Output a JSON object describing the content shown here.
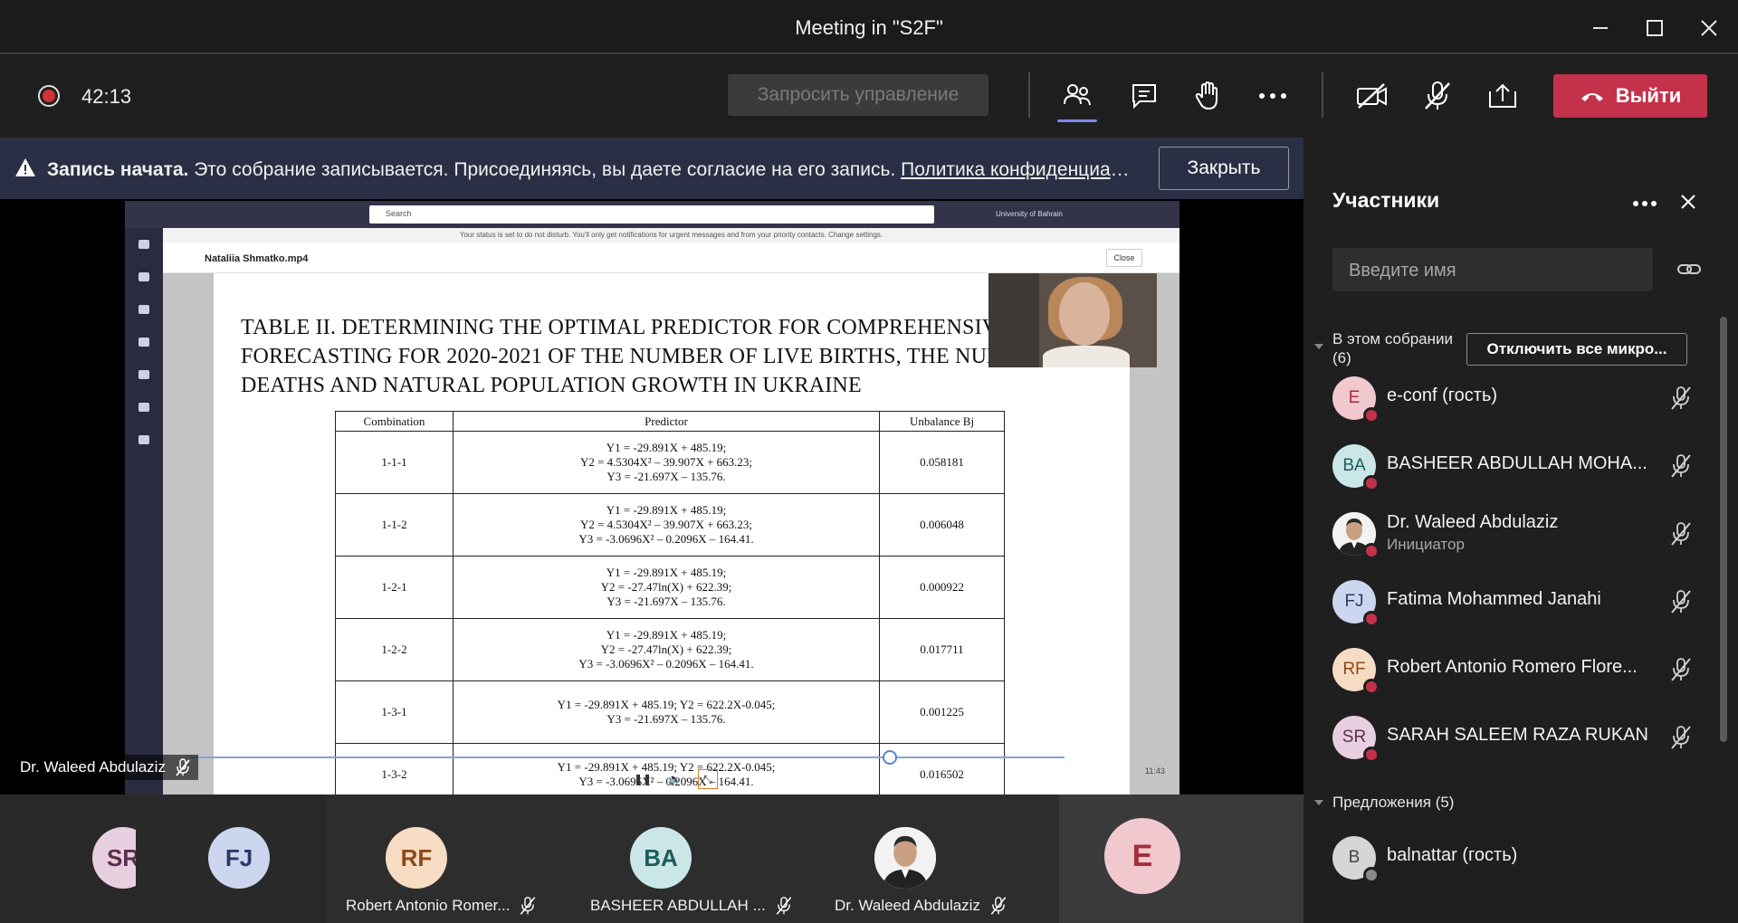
{
  "window": {
    "title": "Meeting in \"S2F\""
  },
  "toolbar": {
    "timer": "42:13",
    "request_control": "Запросить управление",
    "leave_label": "Выйти",
    "accent_leave": "#c4314b"
  },
  "banner": {
    "bold": "Запись начата.",
    "text": " Это собрание записывается. Присоединяясь, вы даете согласие на его запись. ",
    "link": "Политика конфиденциаль...",
    "close_label": "Закрыть"
  },
  "shared_screen": {
    "search_placeholder": "Search",
    "org_label": "University of Bahrain",
    "notice": "Your status is set to do not disturb. You'll only get notifications for urgent messages and from your priority contacts. Change settings.",
    "file_name": "Nataliia Shmatko.mp4",
    "close_label": "Close",
    "slide_title": "TABLE II. DETERMINING THE OPTIMAL PREDICTOR FOR COMPREHENSIVE FORECASTING FOR 2020-2021 OF THE NUMBER OF LIVE BIRTHS, THE NUMBER OF DEATHS AND NATURAL POPULATION GROWTH IN UKRAINE",
    "table_headers": [
      "Combination",
      "Predictor",
      "Unbalance Bj"
    ],
    "table_rows": [
      {
        "combination": "1-1-1",
        "predictor": "Y1 = -29.891X + 485.19;\nY2 = 4.5304X² – 39.907X + 663.23;\nY3 = -21.697X – 135.76.",
        "unbalance": "0.058181"
      },
      {
        "combination": "1-1-2",
        "predictor": "Y1 = -29.891X + 485.19;\nY2 = 4.5304X² – 39.907X + 663.23;\nY3 = -3.0696X² – 0.2096X – 164.41.",
        "unbalance": "0.006048"
      },
      {
        "combination": "1-2-1",
        "predictor": "Y1 = -29.891X + 485.19;\nY2 = -27.47ln(X) + 622.39;\nY3 = -21.697X – 135.76.",
        "unbalance": "0.000922"
      },
      {
        "combination": "1-2-2",
        "predictor": "Y1 = -29.891X + 485.19;\nY2 = -27.47ln(X) + 622.39;\nY3 = -3.0696X² – 0.2096X – 164.41.",
        "unbalance": "0.017711"
      },
      {
        "combination": "1-3-1",
        "predictor": "Y1 = -29.891X + 485.19; Y2 = 622.2X-0.045;\nY3 = -21.697X – 135.76.",
        "unbalance": "0.001225"
      },
      {
        "combination": "1-3-2",
        "predictor": "Y1 = -29.891X + 485.19; Y2 = 622.2X-0.045;\nY3 = -3.0696X² – 0.2096X – 164.41.",
        "unbalance": "0.016502"
      }
    ],
    "video_time": "11:43",
    "playback_progress": 0.8
  },
  "speaker": {
    "name": "Dr. Waleed Abdulaziz"
  },
  "tiles": [
    {
      "initials": "SR",
      "name": "",
      "bg": "#e8cfe0",
      "fg": "#5c2d4f"
    },
    {
      "initials": "FJ",
      "name": "",
      "bg": "#cdd6ef",
      "fg": "#2a3a6a"
    },
    {
      "initials": "RF",
      "name": "Robert Antonio Romer...",
      "bg": "#f7dcc4",
      "fg": "#8a4a1a"
    },
    {
      "initials": "BA",
      "name": "BASHEER ABDULLAH ...",
      "bg": "#cbe6e6",
      "fg": "#1e5c5c"
    },
    {
      "initials": "",
      "name": "Dr. Waleed Abdulaziz",
      "bg": "#e8e8e8",
      "fg": "#333"
    },
    {
      "initials": "E",
      "name": "",
      "bg": "#f2c8cf",
      "fg": "#a52e3e"
    }
  ],
  "panel": {
    "title": "Участники",
    "search_placeholder": "Введите имя",
    "in_meeting": "В этом собрании\n(6)",
    "mute_all": "Отключить все микро...",
    "participants": [
      {
        "initials": "E",
        "name": "e-conf (гость)",
        "sub": "",
        "bg": "#f2c8cf",
        "fg": "#a52e3e"
      },
      {
        "initials": "BA",
        "name": "BASHEER ABDULLAH MOHA...",
        "sub": "",
        "bg": "#cbe6e6",
        "fg": "#1e5c5c"
      },
      {
        "initials": "",
        "name": "Dr. Waleed Abdulaziz",
        "sub": "Инициатор",
        "bg": "#e8e8e8",
        "fg": "#333"
      },
      {
        "initials": "FJ",
        "name": "Fatima Mohammed Janahi",
        "sub": "",
        "bg": "#cdd6ef",
        "fg": "#2a3a6a"
      },
      {
        "initials": "RF",
        "name": "Robert Antonio Romero Flore...",
        "sub": "",
        "bg": "#f7dcc4",
        "fg": "#8a4a1a"
      },
      {
        "initials": "SR",
        "name": "SARAH SALEEM RAZA RUKAN",
        "sub": "",
        "bg": "#e8cfe0",
        "fg": "#5c2d4f"
      }
    ],
    "suggestions": "Предложения (5)",
    "suggested": [
      {
        "initials": "B",
        "name": "balnattar (гость)",
        "bg": "#d6d6d6",
        "fg": "#444"
      }
    ]
  }
}
